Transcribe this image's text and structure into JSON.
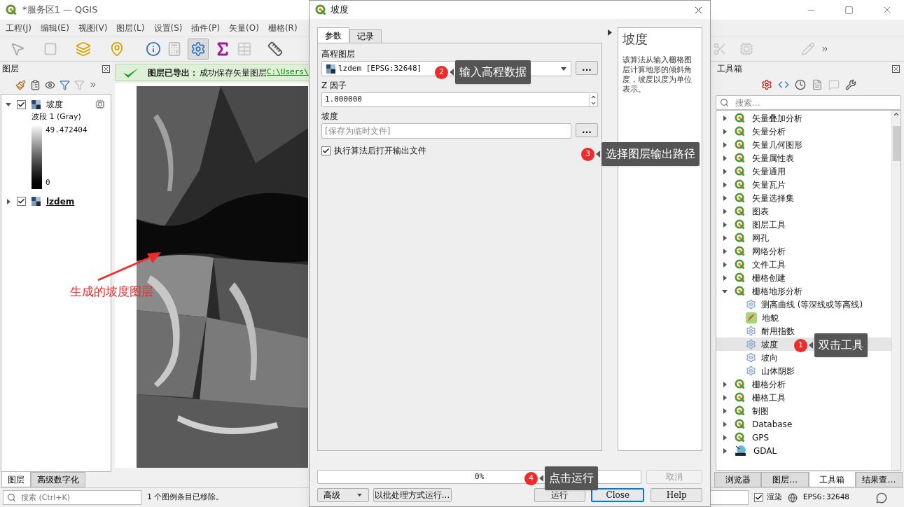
{
  "main_window": {
    "title": "*服务区1 — QGIS"
  },
  "menu": [
    "工程(J)",
    "编辑(E)",
    "视图(V)",
    "图层(L)",
    "设置(S)",
    "插件(P)",
    "矢量(O)",
    "栅格(R)"
  ],
  "message_bar": {
    "title": "图层已导出：",
    "text": "成功保存矢量图层",
    "link": "C:\\Users\\"
  },
  "layers_panel": {
    "title": "图层",
    "layers": [
      {
        "name": "坡度",
        "checked": true,
        "expanded": true,
        "active": false,
        "band": "波段 1 (Gray)",
        "max": "49.472404",
        "min": "0"
      },
      {
        "name": "lzdem",
        "checked": true,
        "expanded": false,
        "active": true
      }
    ],
    "tabs": [
      {
        "label": "图层",
        "selected": true
      },
      {
        "label": "高级数字化",
        "selected": false
      }
    ]
  },
  "map": {
    "annotation": "生成的坡度图层"
  },
  "toolbox": {
    "title": "工具箱",
    "search_placeholder": "搜索...",
    "groups": [
      {
        "kind": "qgis",
        "name": "矢量叠加分析",
        "expanded": false
      },
      {
        "kind": "qgis",
        "name": "矢量分析",
        "expanded": false
      },
      {
        "kind": "qgis",
        "name": "矢量几何图形",
        "expanded": false
      },
      {
        "kind": "qgis",
        "name": "矢量属性表",
        "expanded": false
      },
      {
        "kind": "qgis",
        "name": "矢量通用",
        "expanded": false
      },
      {
        "kind": "qgis",
        "name": "矢量瓦片",
        "expanded": false
      },
      {
        "kind": "qgis",
        "name": "矢量选择集",
        "expanded": false
      },
      {
        "kind": "qgis",
        "name": "图表",
        "expanded": false
      },
      {
        "kind": "qgis",
        "name": "图层工具",
        "expanded": false
      },
      {
        "kind": "qgis",
        "name": "网孔",
        "expanded": false
      },
      {
        "kind": "qgis",
        "name": "网络分析",
        "expanded": false
      },
      {
        "kind": "qgis",
        "name": "文件工具",
        "expanded": false
      },
      {
        "kind": "qgis",
        "name": "栅格创建",
        "expanded": false
      },
      {
        "kind": "qgis",
        "name": "栅格地形分析",
        "expanded": true,
        "children": [
          {
            "kind": "gear",
            "name": "测高曲线 (等深线或等高线)",
            "selected": false
          },
          {
            "kind": "relief",
            "name": "地貌",
            "selected": false
          },
          {
            "kind": "gear",
            "name": "耐用指数",
            "selected": false
          },
          {
            "kind": "gear",
            "name": "坡度",
            "selected": true
          },
          {
            "kind": "gear",
            "name": "坡向",
            "selected": false
          },
          {
            "kind": "gear",
            "name": "山体阴影",
            "selected": false
          }
        ]
      },
      {
        "kind": "qgis",
        "name": "栅格分析",
        "expanded": false
      },
      {
        "kind": "qgis",
        "name": "栅格工具",
        "expanded": false
      },
      {
        "kind": "qgis",
        "name": "制图",
        "expanded": false
      },
      {
        "kind": "qgis",
        "name": "Database",
        "expanded": false
      },
      {
        "kind": "qgis",
        "name": "GPS",
        "expanded": false
      },
      {
        "kind": "gdal",
        "name": "GDAL",
        "expanded": false
      }
    ],
    "tabs": [
      {
        "label": "浏览器",
        "selected": false
      },
      {
        "label": "图层…",
        "selected": false
      },
      {
        "label": "工具箱",
        "selected": true
      },
      {
        "label": "结果查…",
        "selected": false
      }
    ]
  },
  "status_bar": {
    "search_placeholder": "搜索 (Ctrl+K)",
    "message": "1 个图例条目已移除。",
    "render": {
      "label": "渲染",
      "checked": true
    },
    "crs": "EPSG:32648"
  },
  "dialog": {
    "title": "坡度",
    "tabs": [
      {
        "label": "参数",
        "selected": true
      },
      {
        "label": "记录",
        "selected": false
      }
    ],
    "fields": [
      {
        "kind": "combo",
        "label": "高程图层",
        "value": "lzdem [EPSG:32648]",
        "button": "..."
      },
      {
        "kind": "spin",
        "label": "Z 因子",
        "value": "1.000000"
      },
      {
        "kind": "file",
        "label": "坡度",
        "placeholder": "[保存为临时文件]",
        "button": "..."
      }
    ],
    "open_output": {
      "label": "执行算法后打开输出文件",
      "checked": true
    },
    "help": {
      "title": "坡度",
      "text": "该算法从输入栅格图层计算地形的倾斜角度，坡度以度为单位表示。"
    },
    "progress": {
      "level": 0,
      "text": "0%"
    },
    "cancel": {
      "label": "取消",
      "disabled": true
    },
    "buttons": [
      {
        "kind": "dropdown",
        "label": "高级"
      },
      {
        "kind": "plain",
        "label": "以批处理方式运行..."
      },
      {
        "kind": "plain",
        "label": "运行"
      },
      {
        "kind": "default",
        "label": "Close"
      },
      {
        "kind": "plain",
        "label": "Help"
      }
    ]
  },
  "annotations": [
    {
      "number": "1",
      "text": "双击工具"
    },
    {
      "number": "2",
      "text": "输入高程数据"
    },
    {
      "number": "3",
      "text": "选择图层输出路径"
    },
    {
      "number": "4",
      "text": "点击运行"
    }
  ]
}
